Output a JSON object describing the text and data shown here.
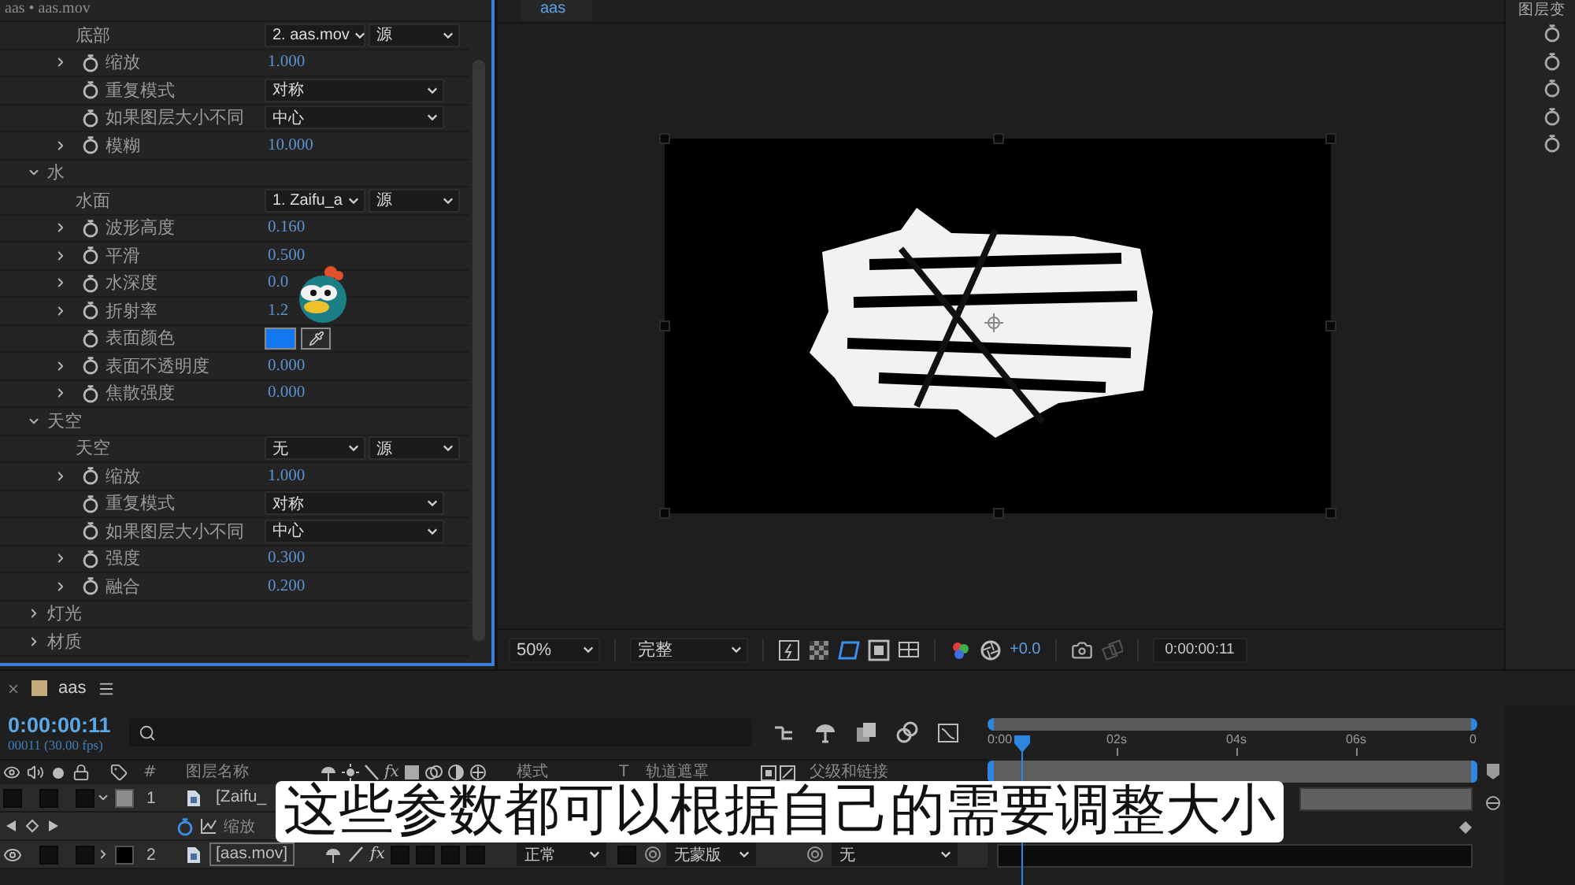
{
  "effects_panel": {
    "title": "aas • aas.mov",
    "rows": [
      {
        "kind": "layer_select",
        "label": "底部",
        "layer": "2. aas.mov",
        "source": "源"
      },
      {
        "kind": "number",
        "label": "缩放",
        "value": "1.000",
        "expanded": false
      },
      {
        "kind": "menu",
        "label": "重复模式",
        "value": "对称"
      },
      {
        "kind": "menu",
        "label": "如果图层大小不同",
        "value": "中心"
      },
      {
        "kind": "number",
        "label": "模糊",
        "value": "10.000",
        "expanded": false
      },
      {
        "kind": "group",
        "label": "水",
        "expanded": true
      },
      {
        "kind": "layer_select",
        "label": "水面",
        "layer": "1. Zaifu_a",
        "source": "源"
      },
      {
        "kind": "number",
        "label": "波形高度",
        "value": "0.160",
        "expanded": false
      },
      {
        "kind": "number",
        "label": "平滑",
        "value": "0.500",
        "expanded": false
      },
      {
        "kind": "number",
        "label": "水深度",
        "value": "0.0",
        "expanded": false
      },
      {
        "kind": "number",
        "label": "折射率",
        "value": "1.2",
        "expanded": false
      },
      {
        "kind": "color",
        "label": "表面颜色",
        "color": "#1677f2"
      },
      {
        "kind": "number",
        "label": "表面不透明度",
        "value": "0.000",
        "expanded": false
      },
      {
        "kind": "number",
        "label": "焦散强度",
        "value": "0.000",
        "expanded": false
      },
      {
        "kind": "group",
        "label": "天空",
        "expanded": true
      },
      {
        "kind": "layer_select",
        "label": "天空",
        "layer": "无",
        "source": "源"
      },
      {
        "kind": "number",
        "label": "缩放",
        "value": "1.000",
        "expanded": false
      },
      {
        "kind": "menu",
        "label": "重复模式",
        "value": "对称"
      },
      {
        "kind": "menu",
        "label": "如果图层大小不同",
        "value": "中心"
      },
      {
        "kind": "number",
        "label": "强度",
        "value": "0.300",
        "expanded": false
      },
      {
        "kind": "number",
        "label": "融合",
        "value": "0.200",
        "expanded": false
      },
      {
        "kind": "group",
        "label": "灯光",
        "expanded": false
      },
      {
        "kind": "group",
        "label": "材质",
        "expanded": false
      }
    ]
  },
  "viewer": {
    "tab": "aas",
    "zoom": "50%",
    "resolution": "完整",
    "exposure": "+0.0",
    "timecode": "0:00:00:11"
  },
  "layer_panel": {
    "title": "图层变"
  },
  "timeline": {
    "tab": "aas",
    "timecode": "0:00:00:11",
    "frame_info": "00011 (30.00 fps)",
    "ruler": [
      "0:00",
      "02s",
      "04s",
      "06s",
      "0"
    ],
    "header": {
      "number": "#",
      "name": "图层名称",
      "fx": "fx",
      "mode": "模式",
      "t": "T",
      "track_matte": "轨道遮罩",
      "parent": "父级和链接"
    },
    "layers": [
      {
        "number": "1",
        "name": "[Zaifu_",
        "color": "#8c8c8c",
        "visible": false,
        "expanded": true,
        "selected": false,
        "properties": [
          {
            "label": "缩放",
            "keyframed": true
          }
        ]
      },
      {
        "number": "2",
        "name": "[aas.mov]",
        "color": "#000000",
        "visible": true,
        "expanded": false,
        "selected": true,
        "fx": "fx",
        "effects_on": true,
        "mode": "正常",
        "track_matte": "无蒙版",
        "parent": "无"
      }
    ]
  },
  "subtitle": "这些参数都可以根据自己的需要调整大小"
}
